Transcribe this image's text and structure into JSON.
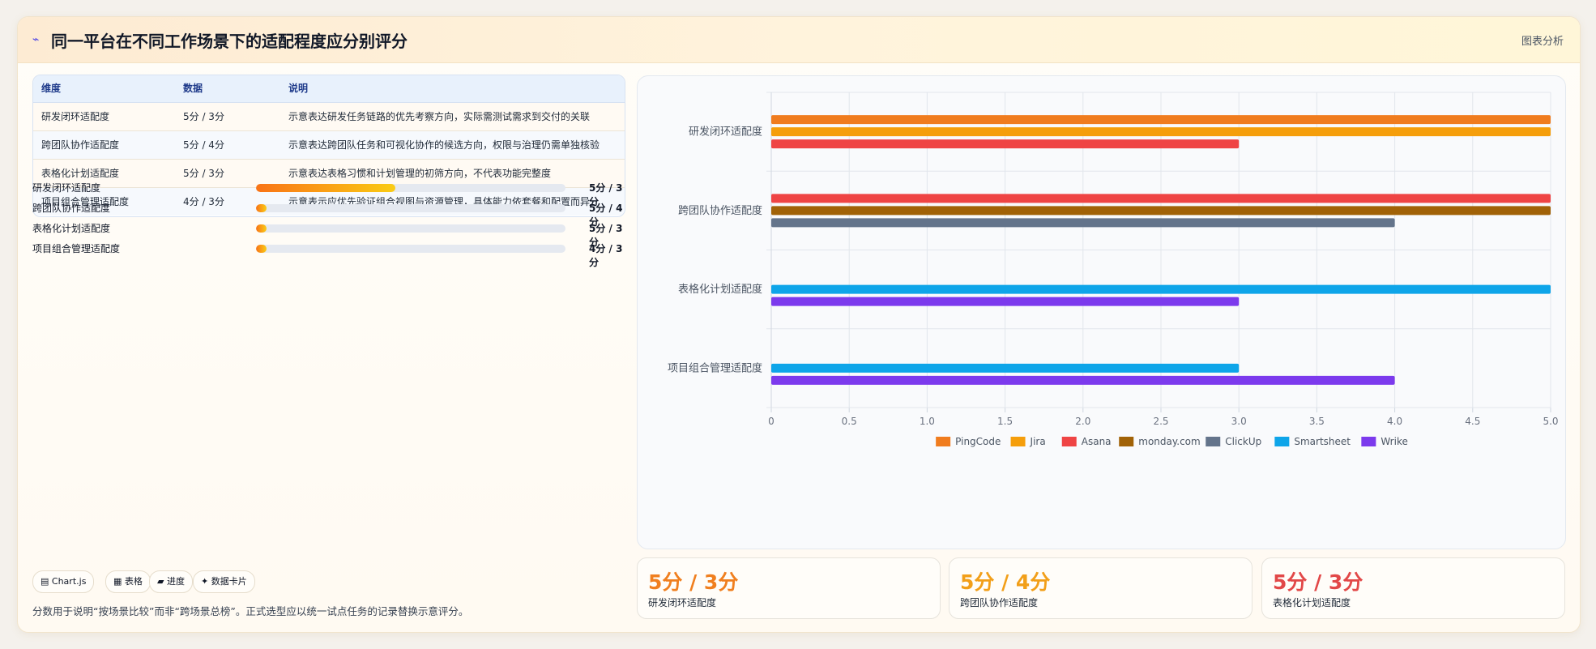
{
  "header": {
    "icon": "line-chart-icon",
    "title": "同一平台在不同工作场景下的适配程度应分别评分",
    "action_label": "图表分析"
  },
  "table": {
    "columns": [
      "维度",
      "数据",
      "说明"
    ],
    "rows": [
      {
        "dimension": "研发闭环适配度",
        "data": "5分 / 3分",
        "note": "示意表达研发任务链路的优先考察方向，实际需测试需求到交付的关联"
      },
      {
        "dimension": "跨团队协作适配度",
        "data": "5分 / 4分",
        "note": "示意表达跨团队任务和可视化协作的候选方向，权限与治理仍需单独核验"
      },
      {
        "dimension": "表格化计划适配度",
        "data": "5分 / 3分",
        "note": "示意表达表格习惯和计划管理的初筛方向，不代表功能完整度"
      },
      {
        "dimension": "项目组合管理适配度",
        "data": "4分 / 3分",
        "note": "示意表示应优先验证组合视图与资源管理，具体能力依套餐和配置而异"
      }
    ]
  },
  "progress": [
    {
      "label": "研发闭环适配度",
      "value_text": "5分 / 3分",
      "fill": 0.45
    },
    {
      "label": "跨团队协作适配度",
      "value_text": "5分 / 4分",
      "fill": 0.035
    },
    {
      "label": "表格化计划适配度",
      "value_text": "5分 / 3分",
      "fill": 0.035
    },
    {
      "label": "项目组合管理适配度",
      "value_text": "4分 / 3分",
      "fill": 0.035
    }
  ],
  "chips": [
    {
      "icon": "chart-icon",
      "glyph": "▤",
      "label": "Chart.js"
    },
    {
      "icon": "table-icon",
      "glyph": "▦",
      "label": "表格"
    },
    {
      "icon": "progress-icon",
      "glyph": "▰",
      "label": "进度"
    },
    {
      "icon": "sparkle-icon",
      "glyph": "✦",
      "label": "数据卡片"
    }
  ],
  "footnote": "分数用于说明“按场景比较”而非“跨场景总榜”。正式选型应以统一试点任务的记录替换示意评分。",
  "kpis": [
    {
      "value": "5分 / 3分",
      "label": "研发闭环适配度",
      "color": "#f07f1f"
    },
    {
      "value": "5分 / 4分",
      "label": "跨团队协作适配度",
      "color": "#f29f19"
    },
    {
      "value": "5分 / 3分",
      "label": "表格化计划适配度",
      "color": "#e24848"
    }
  ],
  "chart_data": {
    "type": "bar",
    "orientation": "horizontal",
    "categories": [
      "研发闭环适配度",
      "跨团队协作适配度",
      "表格化计划适配度",
      "项目组合管理适配度"
    ],
    "series": [
      {
        "name": "PingCode",
        "color": "#f07c1e",
        "values": [
          5,
          null,
          null,
          null
        ]
      },
      {
        "name": "Jira",
        "color": "#f59e0b",
        "values": [
          5,
          null,
          null,
          null
        ]
      },
      {
        "name": "Asana",
        "color": "#ef4444",
        "values": [
          3,
          5,
          null,
          null
        ]
      },
      {
        "name": "monday.com",
        "color": "#a16207",
        "values": [
          null,
          5,
          null,
          null
        ]
      },
      {
        "name": "ClickUp",
        "color": "#64748b",
        "values": [
          null,
          4,
          null,
          null
        ]
      },
      {
        "name": "Smartsheet",
        "color": "#0ea5e9",
        "values": [
          null,
          null,
          5,
          3
        ]
      },
      {
        "name": "Wrike",
        "color": "#7c3aed",
        "values": [
          null,
          null,
          3,
          4
        ]
      }
    ],
    "xlim": [
      0,
      5
    ],
    "xticks": [
      "0",
      "0.5",
      "1.0",
      "1.5",
      "2.0",
      "2.5",
      "3.0",
      "3.5",
      "4.0",
      "4.5",
      "5.0"
    ],
    "grid": true,
    "legend_position": "bottom"
  }
}
